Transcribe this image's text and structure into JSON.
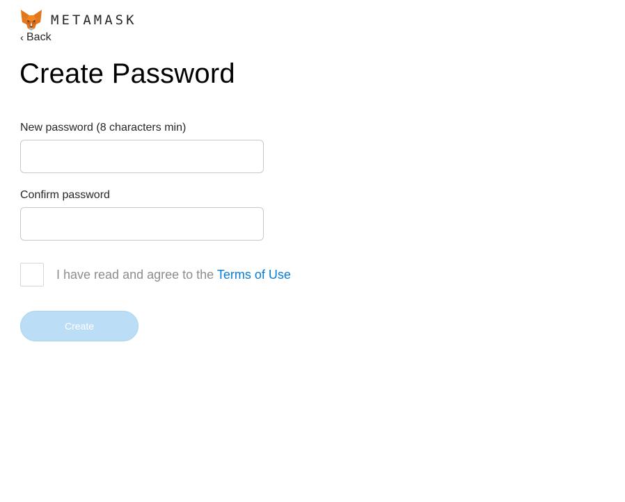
{
  "header": {
    "logo_icon": "metamask-fox-icon",
    "wordmark": "METAMASK"
  },
  "nav": {
    "back_chevron": "‹",
    "back_label": "Back"
  },
  "page": {
    "title": "Create Password"
  },
  "form": {
    "new_password_label": "New password (8 characters min)",
    "new_password_value": "",
    "confirm_password_label": "Confirm password",
    "confirm_password_value": "",
    "terms_prefix": "I have read and agree to the ",
    "terms_link": "Terms of Use",
    "terms_checked": false,
    "create_label": "Create",
    "create_enabled": false
  },
  "colors": {
    "link": "#037dd6",
    "button_disabled_bg": "#bbddf5",
    "fox_orange": "#e2761b"
  }
}
